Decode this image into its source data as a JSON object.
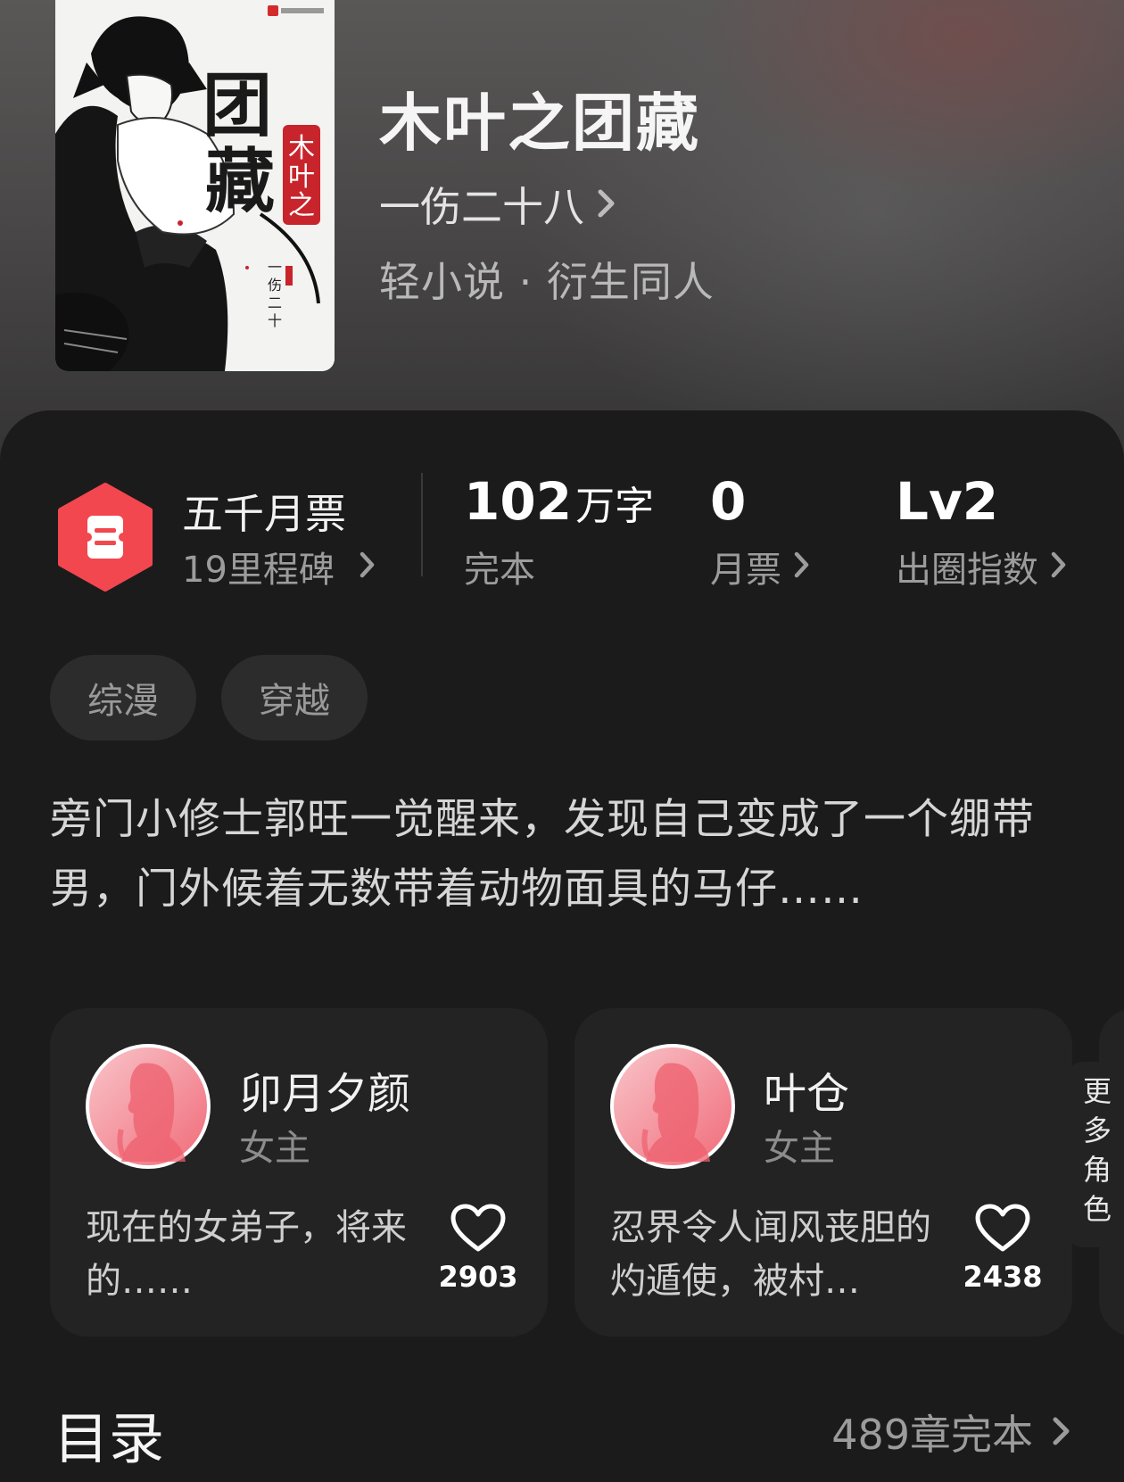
{
  "book": {
    "title": "木叶之团藏",
    "author": "一伤二十八",
    "category": "轻小说 · 衍生同人"
  },
  "milestone": {
    "title": "五千月票",
    "subtitle": "19里程碑",
    "icon": "ticket-icon",
    "badge_color": "#f2474f"
  },
  "stats": {
    "words": {
      "value": "102",
      "unit": "万字",
      "label": "完本"
    },
    "monthly_tickets": {
      "value": "0",
      "label": "月票"
    },
    "breakout_index": {
      "value": "Lv2",
      "label": "出圈指数"
    }
  },
  "tags": [
    "综漫",
    "穿越"
  ],
  "synopsis": "旁门小修士郭旺一觉醒来，发现自己变成了一个绷带男，门外候着无数带着动物面具的马仔……",
  "characters": [
    {
      "name": "卯月夕颜",
      "role": "女主",
      "desc": "现在的女弟子，将来的……",
      "likes": "2903"
    },
    {
      "name": "叶仓",
      "role": "女主",
      "desc": "忍界令人闻风丧胆的灼遁使，被村…",
      "likes": "2438"
    }
  ],
  "more_characters_label": "更多角色",
  "toc": {
    "title": "目录",
    "summary": "489章完本"
  }
}
